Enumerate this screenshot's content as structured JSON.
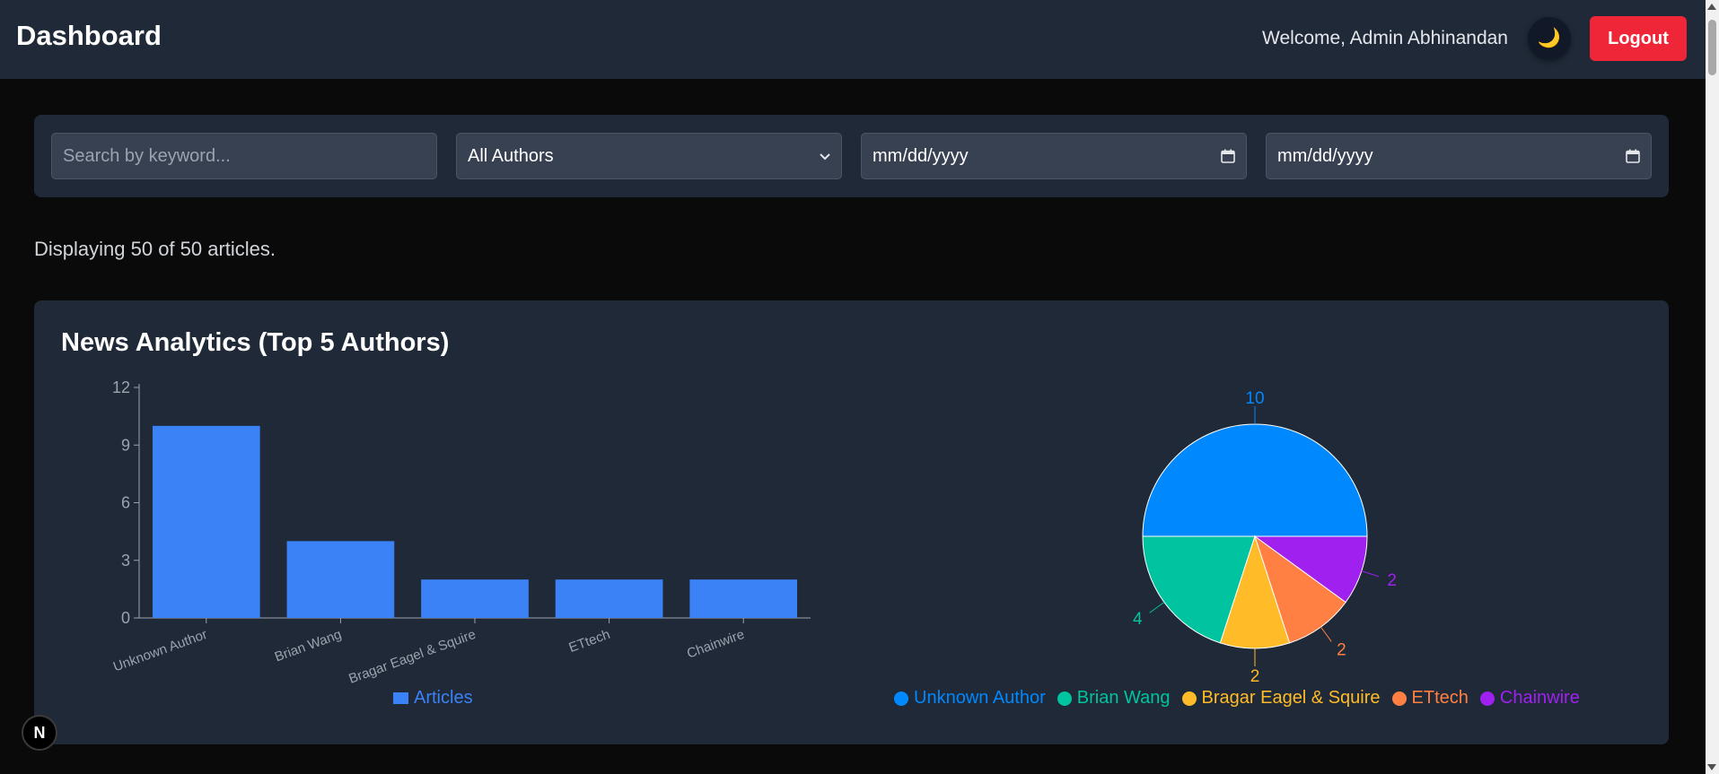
{
  "header": {
    "title": "Dashboard",
    "welcome": "Welcome, Admin Abhinandan",
    "theme_icon": "🌙",
    "logout_label": "Logout"
  },
  "filters": {
    "search_placeholder": "Search by keyword...",
    "author_selected": "All Authors",
    "date_from_placeholder": "mm/dd/yyyy",
    "date_to_placeholder": "mm/dd/yyyy"
  },
  "status": "Displaying 50 of 50 articles.",
  "analytics": {
    "title": "News Analytics (Top 5 Authors)"
  },
  "floating_badge": "N",
  "colors": {
    "bar": "#3b82f6",
    "logout": "#ef2637",
    "pie": [
      "#0088fe",
      "#00c49f",
      "#ffbb28",
      "#ff8042",
      "#a020f0"
    ]
  },
  "chart_data": [
    {
      "type": "bar",
      "categories": [
        "Unknown Author",
        "Brian Wang",
        "Bragar Eagel & Squire",
        "ETtech",
        "Chainwire"
      ],
      "series": [
        {
          "name": "Articles",
          "values": [
            10,
            4,
            2,
            2,
            2
          ]
        }
      ],
      "yticks": [
        0,
        3,
        6,
        9,
        12
      ],
      "ylim": [
        0,
        12
      ],
      "legend": "bottom-center",
      "grid": false
    },
    {
      "type": "pie",
      "labels": [
        "Unknown Author",
        "Brian Wang",
        "Bragar Eagel & Squire",
        "ETtech",
        "Chainwire"
      ],
      "values": [
        10,
        4,
        2,
        2,
        2
      ],
      "legend": "bottom-center"
    }
  ]
}
